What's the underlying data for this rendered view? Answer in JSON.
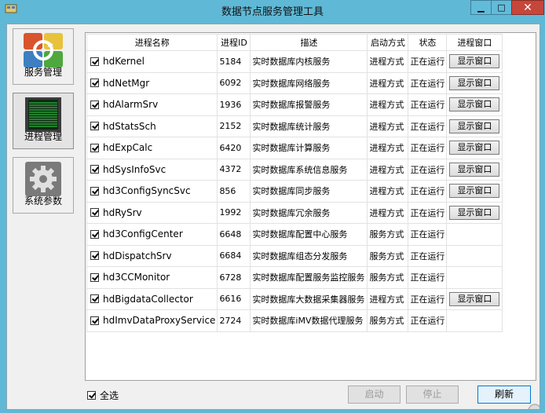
{
  "window": {
    "title": "数据节点服务管理工具",
    "min_glyph": "▁",
    "max_glyph": "□",
    "close_glyph": "✕"
  },
  "sidebar": {
    "items": [
      {
        "label": "服务管理",
        "icon": "services-icon"
      },
      {
        "label": "进程管理",
        "icon": "process-monitor-icon"
      },
      {
        "label": "系统参数",
        "icon": "gear-icon"
      }
    ]
  },
  "table": {
    "headers": [
      "进程名称",
      "进程ID",
      "描述",
      "启动方式",
      "状态",
      "进程窗口"
    ],
    "rows": [
      {
        "name": "hdKernel",
        "pid": "5184",
        "desc": "实时数据库内核服务",
        "mode": "进程方式",
        "status": "正在运行",
        "window": "显示窗口"
      },
      {
        "name": "hdNetMgr",
        "pid": "6092",
        "desc": "实时数据库网络服务",
        "mode": "进程方式",
        "status": "正在运行",
        "window": "显示窗口"
      },
      {
        "name": "hdAlarmSrv",
        "pid": "1936",
        "desc": "实时数据库报警服务",
        "mode": "进程方式",
        "status": "正在运行",
        "window": "显示窗口"
      },
      {
        "name": "hdStatsSch",
        "pid": "2152",
        "desc": "实时数据库统计服务",
        "mode": "进程方式",
        "status": "正在运行",
        "window": "显示窗口"
      },
      {
        "name": "hdExpCalc",
        "pid": "6420",
        "desc": "实时数据库计算服务",
        "mode": "进程方式",
        "status": "正在运行",
        "window": "显示窗口"
      },
      {
        "name": "hdSysInfoSvc",
        "pid": "4372",
        "desc": "实时数据库系统信息服务",
        "mode": "进程方式",
        "status": "正在运行",
        "window": "显示窗口"
      },
      {
        "name": "hd3ConfigSyncSvc",
        "pid": "856",
        "desc": "实时数据库同步服务",
        "mode": "进程方式",
        "status": "正在运行",
        "window": "显示窗口"
      },
      {
        "name": "hdRySrv",
        "pid": "1992",
        "desc": "实时数据库冗余服务",
        "mode": "进程方式",
        "status": "正在运行",
        "window": "显示窗口"
      },
      {
        "name": "hd3ConfigCenter",
        "pid": "6648",
        "desc": "实时数据库配置中心服务",
        "mode": "服务方式",
        "status": "正在运行",
        "window": ""
      },
      {
        "name": "hdDispatchSrv",
        "pid": "6684",
        "desc": "实时数据库组态分发服务",
        "mode": "服务方式",
        "status": "正在运行",
        "window": ""
      },
      {
        "name": "hd3CCMonitor",
        "pid": "6728",
        "desc": "实时数据库配置服务监控服务",
        "mode": "服务方式",
        "status": "正在运行",
        "window": ""
      },
      {
        "name": "hdBigdataCollector",
        "pid": "6616",
        "desc": "实时数据库大数据采集器服务",
        "mode": "进程方式",
        "status": "正在运行",
        "window": "显示窗口"
      },
      {
        "name": "hdImvDataProxyService",
        "pid": "2724",
        "desc": "实时数据库iMV数据代理服务",
        "mode": "服务方式",
        "status": "正在运行",
        "window": ""
      }
    ]
  },
  "footer": {
    "select_all": "全选",
    "start": "启动",
    "stop": "停止",
    "refresh": "刷新"
  },
  "colors": {
    "frame": "#5fb8d6",
    "close": "#c7463a",
    "focus": "#0078d7"
  }
}
